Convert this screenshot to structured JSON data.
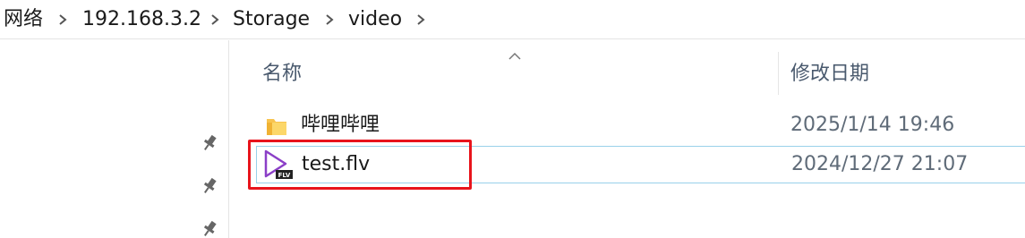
{
  "breadcrumb": {
    "items": [
      "网络",
      "192.168.3.2",
      "Storage",
      "video"
    ]
  },
  "columns": {
    "name": "名称",
    "modified": "修改日期"
  },
  "files": [
    {
      "name": "哔哩哔哩",
      "modified": "2025/1/14 19:46",
      "icon": "folder-icon"
    },
    {
      "name": "test.flv",
      "modified": "2024/12/27 21:07",
      "icon": "flv-video-file-icon",
      "badge": "FLV"
    }
  ],
  "colors": {
    "highlight": "#e8141c",
    "selection_border": "#99d1ea",
    "folder": "#f8c44f",
    "flv_accent": "#8b3fc7"
  }
}
